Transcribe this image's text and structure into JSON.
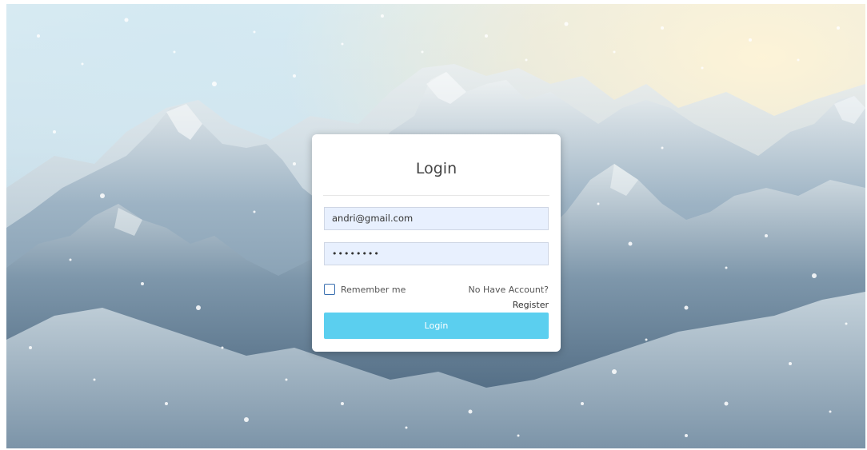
{
  "background": {
    "description_icon": "snowy-mountains-image"
  },
  "login_card": {
    "title": "Login",
    "email_value": "andri@gmail.com",
    "password_value": "••••••••",
    "remember_label": "Remember me",
    "remember_checked": false,
    "no_account_text": "No Have Account?",
    "register_label": "Register",
    "login_button_label": "Login"
  },
  "colors": {
    "button": "#5bcfef",
    "input_bg": "#e8f0fe",
    "checkbox_border": "#3a6fb0"
  }
}
